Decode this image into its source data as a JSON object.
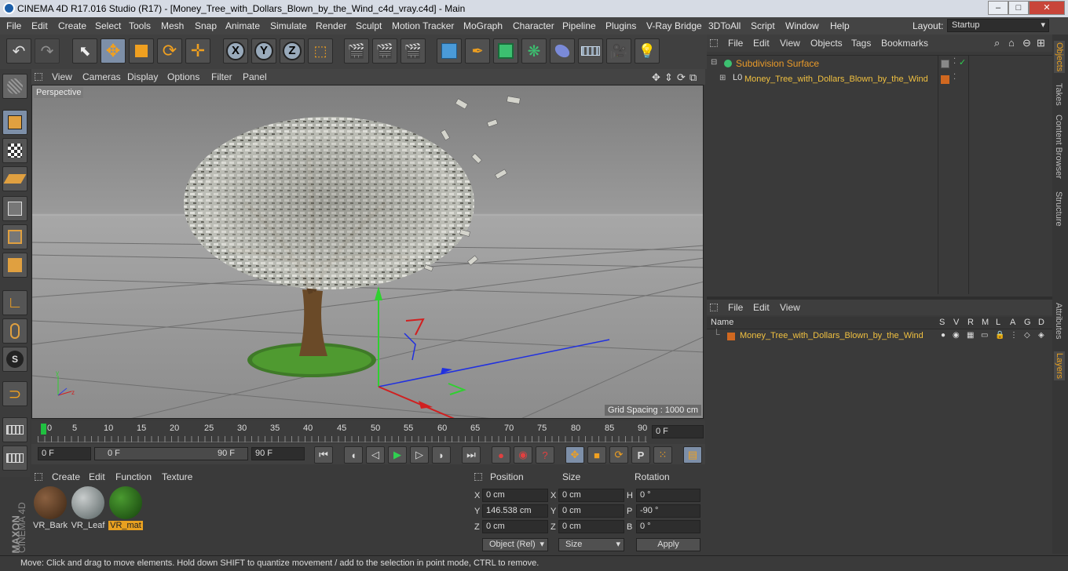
{
  "window": {
    "title": "CINEMA 4D R17.016 Studio (R17) - [Money_Tree_with_Dollars_Blown_by_the_Wind_c4d_vray.c4d] - Main",
    "minimize": "–",
    "maximize": "□",
    "close": "✕"
  },
  "menu": [
    "File",
    "Edit",
    "Create",
    "Select",
    "Tools",
    "Mesh",
    "Snap",
    "Animate",
    "Simulate",
    "Render",
    "Sculpt",
    "Motion Tracker",
    "MoGraph",
    "Character",
    "Pipeline",
    "Plugins",
    "V-Ray Bridge",
    "3DToAll",
    "Script",
    "Window",
    "Help"
  ],
  "layout": {
    "label": "Layout:",
    "value": "Startup"
  },
  "toolbar": {
    "x": "X",
    "y": "Y",
    "z": "Z"
  },
  "viewport": {
    "menu": [
      "View",
      "Cameras",
      "Display",
      "Options",
      "Filter",
      "Panel"
    ],
    "label": "Perspective",
    "grid_spacing": "Grid Spacing : 1000 cm"
  },
  "timeline": {
    "ticks": [
      "0",
      "5",
      "10",
      "15",
      "20",
      "25",
      "30",
      "35",
      "40",
      "45",
      "50",
      "55",
      "60",
      "65",
      "70",
      "75",
      "80",
      "85",
      "90"
    ],
    "current_frame": "0 F"
  },
  "playback": {
    "start": "0 F",
    "range_start": "0 F",
    "range_end": "90 F",
    "end": "90 F"
  },
  "materials": {
    "menu": [
      "Create",
      "Edit",
      "Function",
      "Texture"
    ],
    "items": [
      {
        "name": "VR_Bark",
        "color": "#5a3a20"
      },
      {
        "name": "VR_Leaf",
        "color": "#8a9090"
      },
      {
        "name": "VR_mat",
        "color": "#2e6a1e"
      }
    ]
  },
  "coordinates": {
    "headers": [
      "Position",
      "Size",
      "Rotation"
    ],
    "rows": [
      {
        "axis": "X",
        "pos": "0 cm",
        "saxis": "X",
        "size": "0 cm",
        "raxis": "H",
        "rot": "0 °"
      },
      {
        "axis": "Y",
        "pos": "146.538 cm",
        "saxis": "Y",
        "size": "0 cm",
        "raxis": "P",
        "rot": "-90 °"
      },
      {
        "axis": "Z",
        "pos": "0 cm",
        "saxis": "Z",
        "size": "0 cm",
        "raxis": "B",
        "rot": "0 °"
      }
    ],
    "mode": "Object (Rel)",
    "size_mode": "Size",
    "apply": "Apply"
  },
  "objects": {
    "menu": [
      "File",
      "Edit",
      "View",
      "Objects",
      "Tags",
      "Bookmarks"
    ],
    "items": [
      {
        "name": "Subdivision Surface",
        "color": "#e89a2a"
      },
      {
        "name": "Money_Tree_with_Dollars_Blown_by_the_Wind",
        "color": "#f0c040"
      }
    ]
  },
  "layers": {
    "menu": [
      "File",
      "Edit",
      "View"
    ],
    "name_header": "Name",
    "cols": [
      "S",
      "V",
      "R",
      "M",
      "L",
      "A",
      "G",
      "D"
    ],
    "items": [
      {
        "name": "Money_Tree_with_Dollars_Blown_by_the_Wind",
        "color": "#f0c040"
      }
    ]
  },
  "side_tabs": [
    "Objects",
    "Takes",
    "Content Browser",
    "Structure",
    "Attributes",
    "Layers"
  ],
  "brand": {
    "maxon": "MAXON",
    "product": "CINEMA 4D"
  },
  "status": "Move: Click and drag to move elements. Hold down SHIFT to quantize movement / add to the selection in point mode, CTRL to remove.",
  "colors": {
    "accent": "#e8a020",
    "selection": "#7d8fa8",
    "panel": "#3a3a3a"
  }
}
